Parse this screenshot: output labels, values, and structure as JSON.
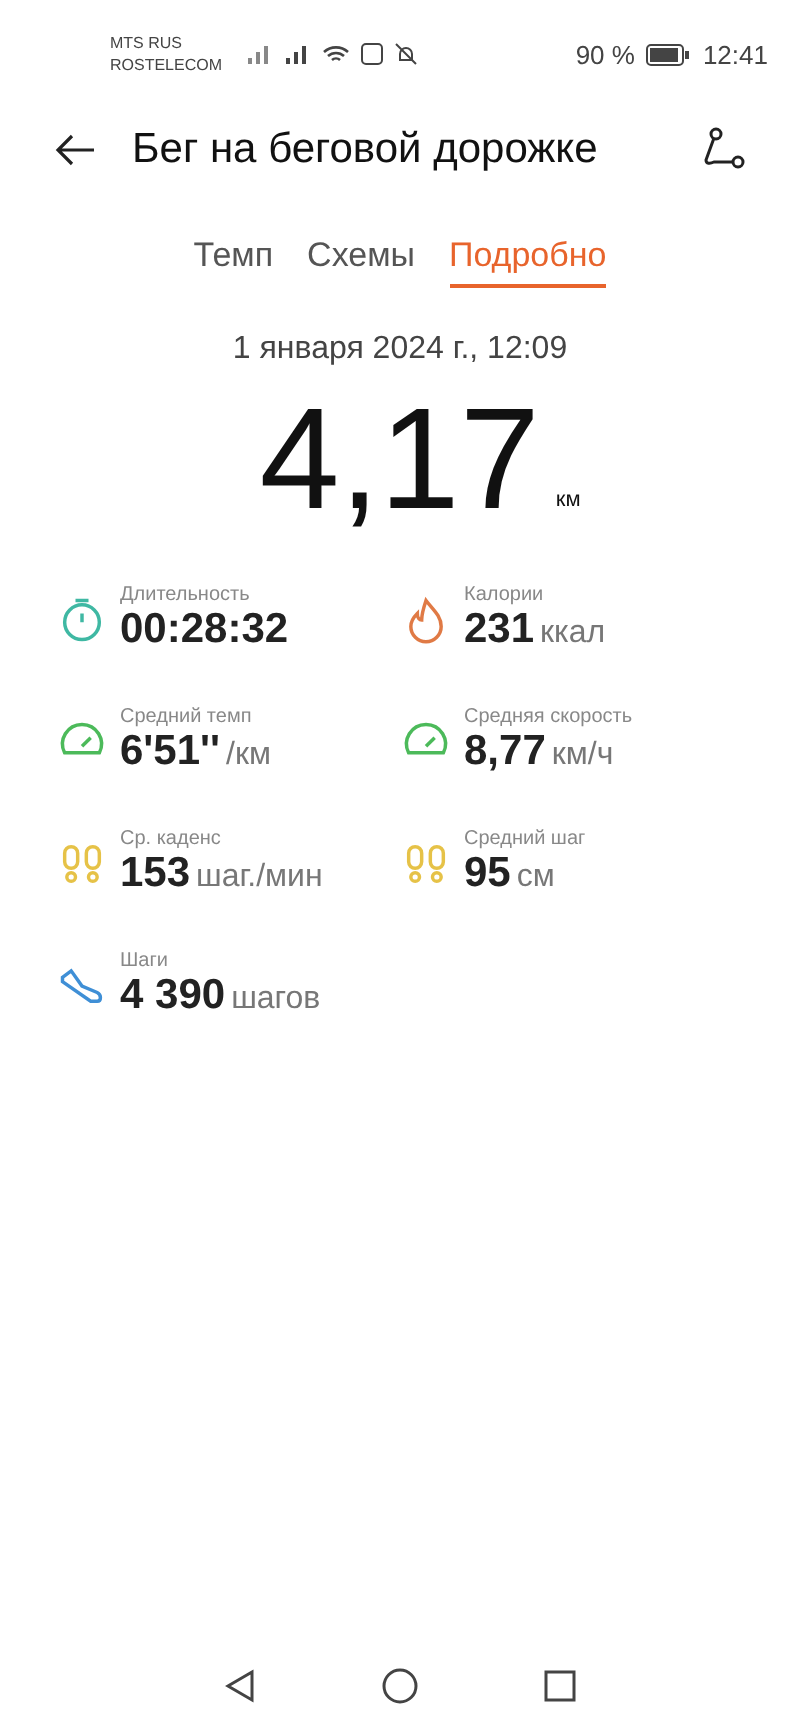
{
  "status_bar": {
    "carriers": [
      "MTS RUS",
      "ROSTELECOM"
    ],
    "battery_percent": "90 %",
    "time": "12:41"
  },
  "header": {
    "title": "Бег на беговой дорожке"
  },
  "tabs": [
    {
      "label": "Темп",
      "selected": false
    },
    {
      "label": "Схемы",
      "selected": false
    },
    {
      "label": "Подробно",
      "selected": true
    }
  ],
  "date": "1 января 2024 г., 12:09",
  "distance": {
    "value": "4,17",
    "unit": "км"
  },
  "metrics": [
    {
      "kind": "stopwatch",
      "label": "Длительность",
      "value": "00:28:32"
    },
    {
      "kind": "flame",
      "label": "Калории",
      "value": "231",
      "unit": "ккал"
    },
    {
      "kind": "gauge",
      "label": "Средний темп",
      "value": "6'51''",
      "unit": "/км"
    },
    {
      "kind": "gauge",
      "label": "Средняя скорость",
      "value": "8,77",
      "unit": "км/ч"
    },
    {
      "kind": "footprints",
      "label": "Ср. каденс",
      "value": "153",
      "unit": "шаг./мин"
    },
    {
      "kind": "footprints",
      "label": "Средний шаг",
      "value": "95",
      "unit": "см"
    },
    {
      "kind": "shoe",
      "label": "Шаги",
      "value": "4 390",
      "unit": "шагов"
    }
  ]
}
